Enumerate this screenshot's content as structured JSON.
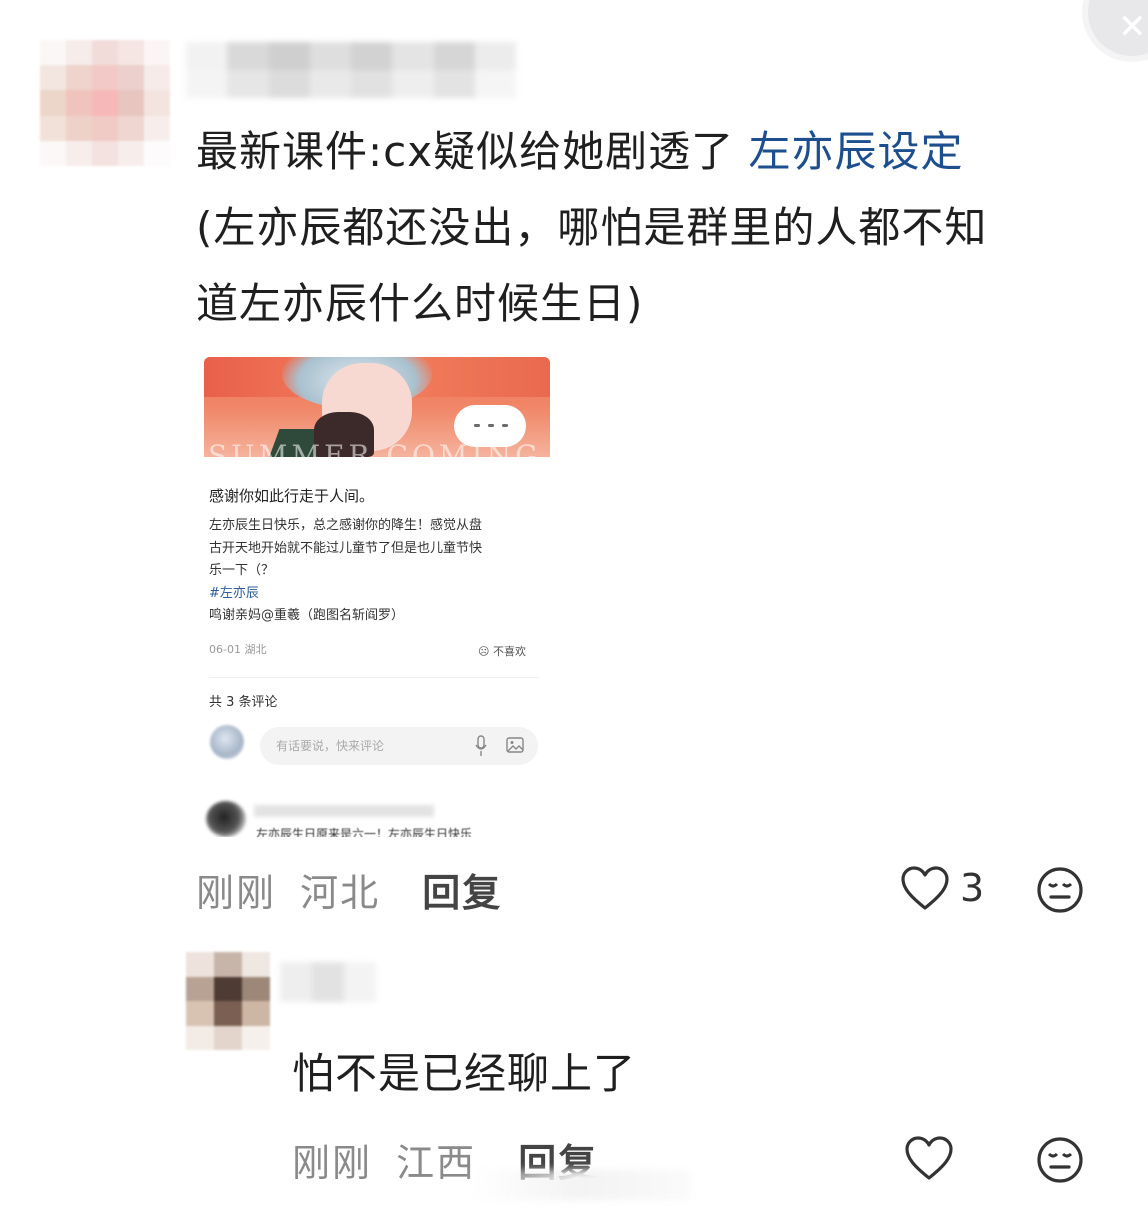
{
  "comment1": {
    "text_main": "最新课件:cx疑似给她剧透了 ",
    "text_link": "左亦辰设定",
    "text_line2": "(左亦辰都还没出，哪怕是群里的人都不知",
    "text_line3": "道左亦辰什么时候生日)",
    "time": "刚刚",
    "location": "河北",
    "reply_label": "回复",
    "like_count": "3"
  },
  "embedded_post": {
    "banner_watermark": "SUMMER COMING",
    "title": "感谢你如此行走于人间。",
    "body_line1": "左亦辰生日快乐，总之感谢你的降生！感觉从盘",
    "body_line2": "古开天地开始就不能过儿童节了但是也儿童节快",
    "body_line3": "乐一下（？",
    "hashtag": "#左亦辰",
    "credit": "鸣谢亲妈@重羲（跑图名斩阎罗）",
    "date_location": "06-01 湖北",
    "dislike_label": "不喜欢",
    "comment_count": "共 3 条评论",
    "input_placeholder": "有话要说，快来评论",
    "first_comment": "左亦辰生日原来是六一！左亦辰生日快乐"
  },
  "comment2": {
    "text": "怕不是已经聊上了",
    "time": "刚刚",
    "location": "江西",
    "reply_label": "回复"
  },
  "colors": {
    "link": "#1d4f8f",
    "meta": "#8a8a8a",
    "icon": "#333333"
  },
  "icons": [
    "heart-icon",
    "neutral-face-icon",
    "microphone-icon",
    "image-icon",
    "close-icon"
  ]
}
